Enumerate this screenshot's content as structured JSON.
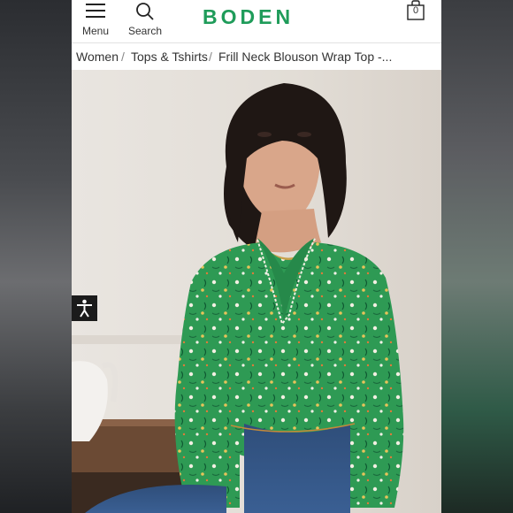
{
  "header": {
    "menu_label": "Menu",
    "search_label": "Search",
    "logo": "BODEN",
    "bag_count": "0"
  },
  "breadcrumb": {
    "items": [
      "Women",
      "Tops & Tshirts",
      "Frill Neck Blouson Wrap Top -..."
    ],
    "separator": "/"
  },
  "colors": {
    "brand_green": "#1f9c5a",
    "top_green": "#2e9a54",
    "jeans_blue": "#3a5f93"
  },
  "icons": [
    "hamburger-icon",
    "search-icon",
    "shopping-bag-icon",
    "accessibility-icon"
  ]
}
